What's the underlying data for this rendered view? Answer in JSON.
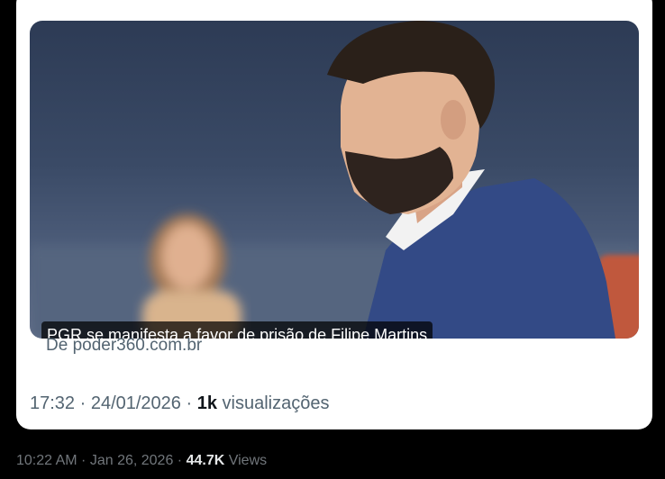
{
  "embed": {
    "card": {
      "headline": "PGR se manifesta a favor de prisão de Filipe Martins",
      "source": "De poder360.com.br"
    },
    "timestamp": "17:32 · 24/01/2026",
    "separator": "·",
    "views_count": "1k",
    "views_label": "visualizações"
  },
  "tweet": {
    "timestamp": "10:22 AM · Jan 26, 2026",
    "separator": "·",
    "views_count": "44.7K",
    "views_label": "Views"
  }
}
